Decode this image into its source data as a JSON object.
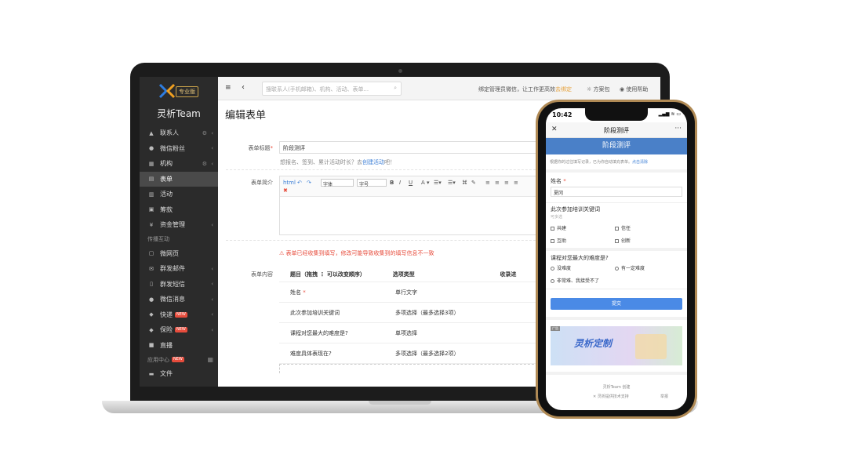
{
  "sidebar": {
    "pro_badge": "专业版",
    "brand": "灵析Team",
    "items": [
      {
        "icon": "contacts-icon",
        "glyph": "▲",
        "label": "联系人",
        "gear": true,
        "arrow": true
      },
      {
        "icon": "wechat-fans-icon",
        "glyph": "●",
        "label": "微信粉丝",
        "arrow": true
      },
      {
        "icon": "org-icon",
        "glyph": "▦",
        "label": "机构",
        "gear": true,
        "arrow": true
      },
      {
        "icon": "form-icon",
        "glyph": "▤",
        "label": "表单",
        "active": true
      },
      {
        "icon": "activity-icon",
        "glyph": "▥",
        "label": "活动"
      },
      {
        "icon": "fundraise-icon",
        "glyph": "▣",
        "label": "筹款"
      },
      {
        "icon": "funds-icon",
        "glyph": "¥",
        "label": "资金管理",
        "arrow": true
      }
    ],
    "section1": "传播互动",
    "items2": [
      {
        "icon": "webpage-icon",
        "glyph": "▢",
        "label": "微网页"
      },
      {
        "icon": "mail-icon",
        "glyph": "✉",
        "label": "群发邮件",
        "arrow": true
      },
      {
        "icon": "sms-icon",
        "glyph": "▯",
        "label": "群发短信",
        "arrow": true
      },
      {
        "icon": "wechat-msg-icon",
        "glyph": "●",
        "label": "微信消息",
        "arrow": true
      },
      {
        "icon": "express-icon",
        "glyph": "◆",
        "label": "快递",
        "new": "NEW",
        "arrow": true
      },
      {
        "icon": "insurance-icon",
        "glyph": "◆",
        "label": "保险",
        "new": "NEW",
        "arrow": true
      },
      {
        "icon": "live-icon",
        "glyph": "■",
        "label": "直播"
      }
    ],
    "section2": "应用中心",
    "section2_new": "NEW",
    "items3": [
      {
        "icon": "file-icon",
        "glyph": "▬",
        "label": "文件"
      }
    ]
  },
  "topbar": {
    "search_placeholder": "搜联系人(手机邮箱)、机构、活动、表单...",
    "notice_text": "绑定管理员微信，让工作更高效",
    "notice_link": "去绑定",
    "plan": "方案包",
    "help": "使用帮助"
  },
  "main": {
    "page_title": "编辑表单",
    "title_label": "表单标题",
    "title_value": "阶段测评",
    "hint_text": "想报名、签到、累计活动时长？去",
    "hint_link": "创建活动",
    "hint_tail": "吧！",
    "intro_label": "表单简介",
    "editor": {
      "font": "字体",
      "size": "字号"
    },
    "warning": "表单已经收集到填写，修改可能导致收集到的填写信息不一致",
    "content_label": "表单内容",
    "table": {
      "headers": [
        "题目（拖拽 ⋮ 可以改变顺序）",
        "选项类型",
        "收录进"
      ],
      "rows": [
        {
          "q": "姓名",
          "required": "*",
          "type": "单行文字"
        },
        {
          "q": "此次参加培训关键词",
          "type": "多项选择（最多选择3项）"
        },
        {
          "q": "课程对您最大的难度是?",
          "type": "单项选择"
        },
        {
          "q": "难度具体表现在?",
          "type": "多项选择（最多选择2项）"
        }
      ]
    }
  },
  "phone": {
    "time": "10:42",
    "status": "▂▄▆ ≋ ▭",
    "nav_title": "阶段测评",
    "banner": "阶段测评",
    "tip": "根据你的过往填写记录，已为你自动填充表单。",
    "tip_link": "点击清除",
    "name_label": "姓名",
    "name_required": "*",
    "name_value": "夏冈",
    "q1": "此次参加培训关键词",
    "q1_sub": "可多选",
    "q1_options": [
      "共建",
      "信任",
      "互助",
      "创新"
    ],
    "q2": "课程对您最大的难度是?",
    "q2_options": [
      "没难度",
      "有一定难度",
      "非常难、我接受不了"
    ],
    "submit": "提交",
    "ad_tag": "广告",
    "ad_text": "灵析定制",
    "footer": "灵析Team 创建",
    "footer2": "灵析提供技术支持",
    "report": "举报"
  }
}
